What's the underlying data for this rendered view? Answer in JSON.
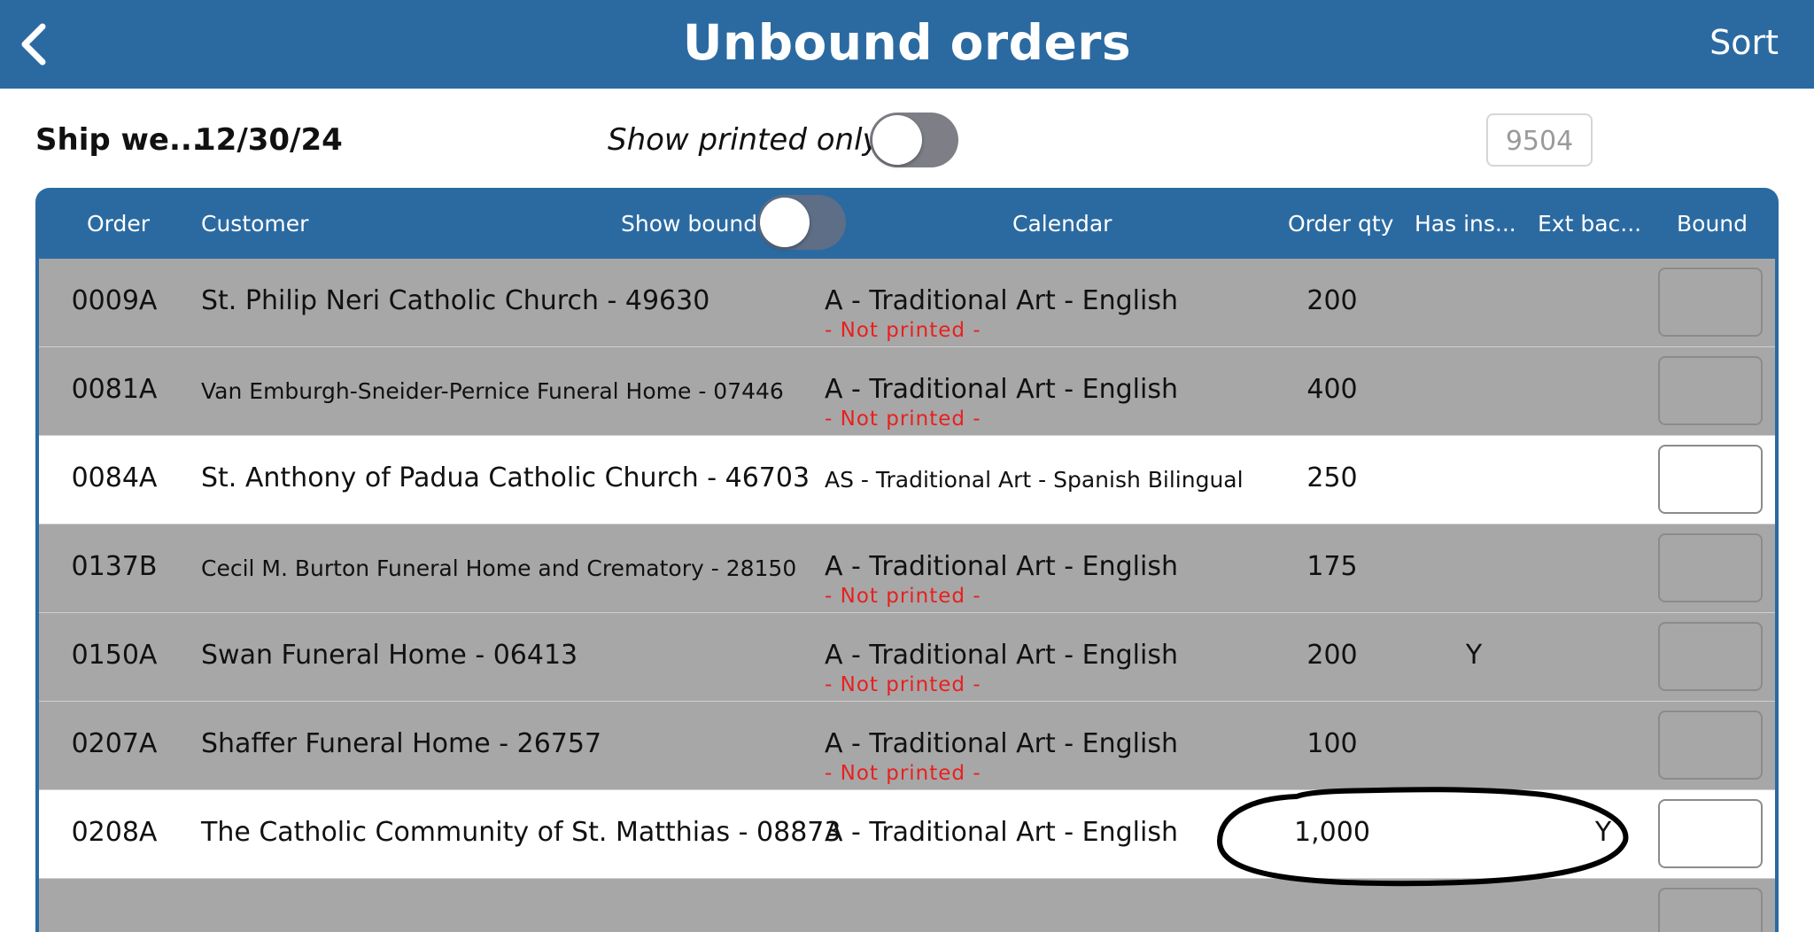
{
  "nav": {
    "title": "Unbound orders",
    "sort_label": "Sort",
    "back_icon": "chevron-left-icon"
  },
  "filters": {
    "ship_label": "Ship we...",
    "ship_date": "12/30/24",
    "show_printed_label": "Show printed only",
    "show_printed_on": false,
    "count": "9504"
  },
  "table": {
    "headers": {
      "order": "Order",
      "customer": "Customer",
      "show_bound": "Show bound",
      "calendar": "Calendar",
      "qty": "Order qty",
      "has_ins": "Has ins...",
      "ext_bac": "Ext bac...",
      "bound": "Bound"
    },
    "show_bound_on": false,
    "not_printed_label": "- Not printed -",
    "rows": [
      {
        "order": "0009A",
        "customer": "St. Philip Neri Catholic Church - 49630",
        "calendar": "A - Traditional Art - English",
        "not_printed": "- Not printed -",
        "qty": "200",
        "has_ins": "",
        "ext_bac": ""
      },
      {
        "order": "0081A",
        "customer": "Van Emburgh-Sneider-Pernice Funeral Home - 07446",
        "calendar": "A - Traditional Art - English",
        "not_printed": "- Not printed -",
        "qty": "400",
        "has_ins": "",
        "ext_bac": ""
      },
      {
        "order": "0084A",
        "customer": "St. Anthony of Padua Catholic Church - 46703",
        "calendar": "AS - Traditional Art - Spanish Bilingual",
        "not_printed": "",
        "qty": "250",
        "has_ins": "",
        "ext_bac": ""
      },
      {
        "order": "0137B",
        "customer": "Cecil M. Burton Funeral Home and Crematory - 28150",
        "calendar": "A - Traditional Art - English",
        "not_printed": "- Not printed -",
        "qty": "175",
        "has_ins": "",
        "ext_bac": ""
      },
      {
        "order": "0150A",
        "customer": "Swan Funeral Home - 06413",
        "calendar": "A - Traditional Art - English",
        "not_printed": "- Not printed -",
        "qty": "200",
        "has_ins": "Y",
        "ext_bac": ""
      },
      {
        "order": "0207A",
        "customer": "Shaffer Funeral Home - 26757",
        "calendar": "A - Traditional Art - English",
        "not_printed": "- Not printed -",
        "qty": "100",
        "has_ins": "",
        "ext_bac": ""
      },
      {
        "order": "0208A",
        "customer": "The Catholic Community of St. Matthias - 08873",
        "calendar": "A - Traditional Art - English",
        "not_printed": "",
        "qty": "1,000",
        "has_ins": "",
        "ext_bac": "Y"
      }
    ]
  }
}
